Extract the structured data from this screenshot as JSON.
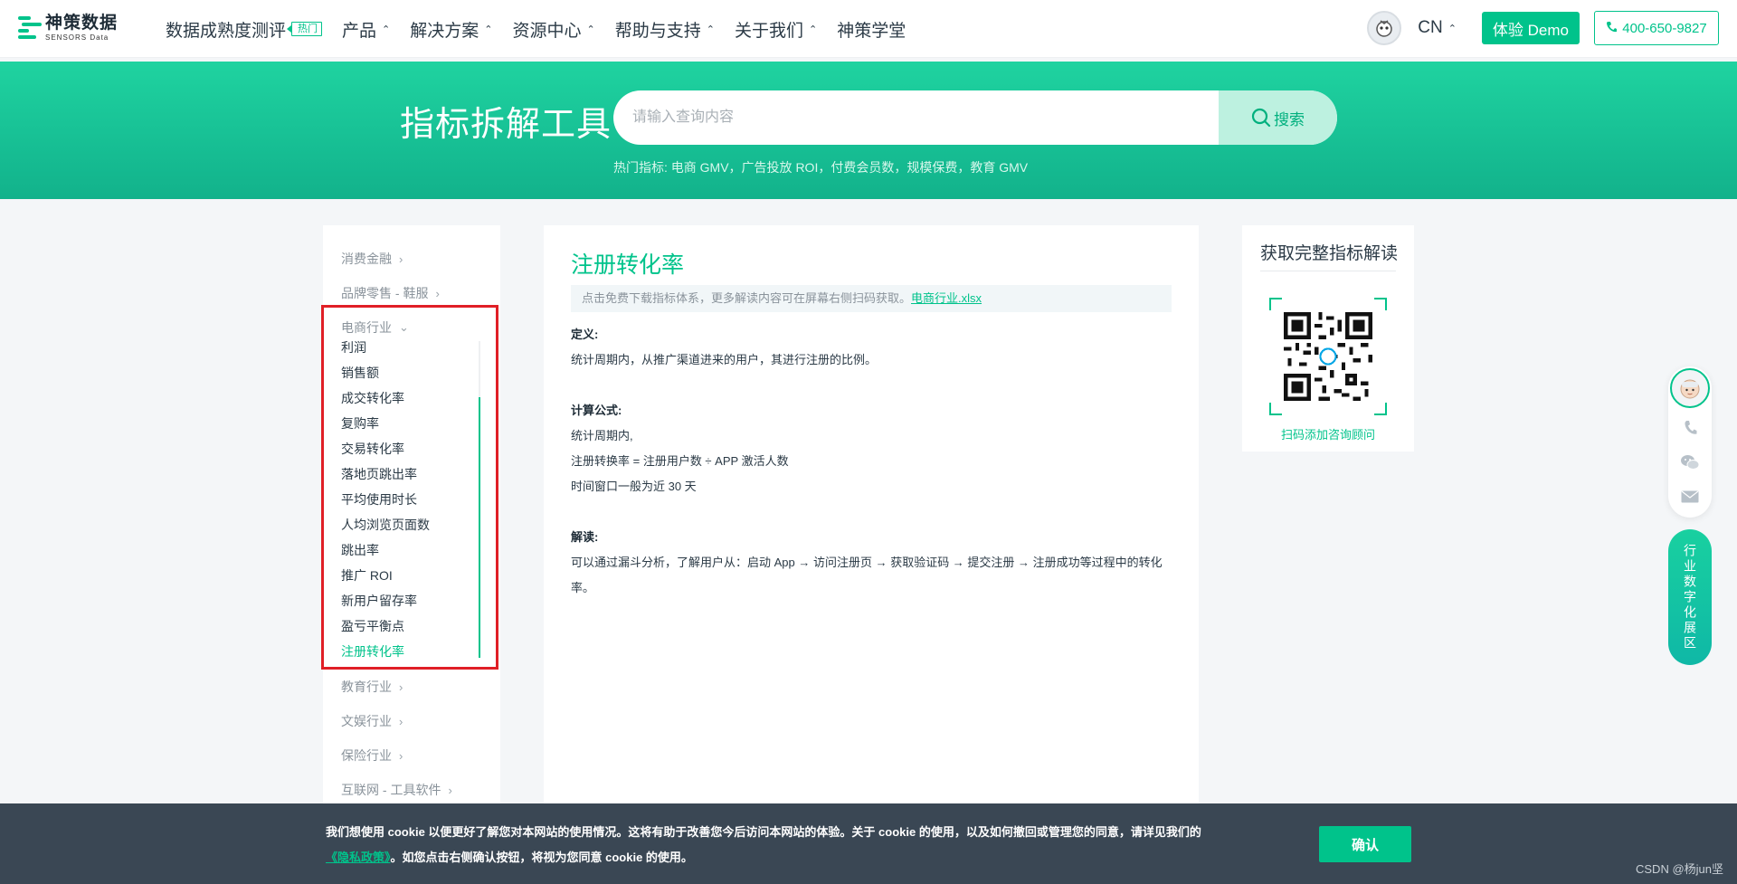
{
  "header": {
    "logo_cn": "神策数据",
    "logo_en": "SENSORS Data",
    "nav": [
      {
        "label": "数据成熟度测评",
        "tag": "热门",
        "dropdown": false
      },
      {
        "label": "产品",
        "dropdown": true
      },
      {
        "label": "解决方案",
        "dropdown": true
      },
      {
        "label": "资源中心",
        "dropdown": true
      },
      {
        "label": "帮助与支持",
        "dropdown": true
      },
      {
        "label": "关于我们",
        "dropdown": true
      },
      {
        "label": "神策学堂",
        "dropdown": false
      }
    ],
    "lang": "CN",
    "demo_label": "体验 Demo",
    "phone": "400-650-9827"
  },
  "hero": {
    "title": "指标拆解工具",
    "search_placeholder": "请输入查询内容",
    "search_button": "搜索",
    "hot_label": "热门指标:",
    "hot_items": "电商 GMV，广告投放 ROI，付费会员数，规模保费，教育 GMV"
  },
  "sidebar": {
    "categories_top": [
      "消费金融",
      "品牌零售 - 鞋服"
    ],
    "expanded_category": "电商行业",
    "sub_items": [
      "利润",
      "销售额",
      "成交转化率",
      "复购率",
      "交易转化率",
      "落地页跳出率",
      "平均使用时长",
      "人均浏览页面数",
      "跳出率",
      "推广 ROI",
      "新用户留存率",
      "盈亏平衡点",
      "注册转化率"
    ],
    "active_item": "注册转化率",
    "categories_bottom": [
      "教育行业",
      "文娱行业",
      "保险行业",
      "互联网 - 工具软件"
    ]
  },
  "main": {
    "title": "注册转化率",
    "notice": "点击免费下载指标体系，更多解读内容可在屏幕右侧扫码获取。",
    "notice_link": "电商行业.xlsx",
    "definition_label": "定义:",
    "definition": "统计周期内，从推广渠道进来的用户，其进行注册的比例。",
    "formula_label": "计算公式:",
    "formula_lines": [
      "统计周期内,",
      "注册转换率 = 注册用户数 ÷ APP 激活人数",
      "时间窗口一般为近 30 天"
    ],
    "interpretation_label": "解读:",
    "interpretation": "可以通过漏斗分析，了解用户从：启动 App → 访问注册页 → 获取验证码 → 提交注册 → 注册成功等过程中的转化率。"
  },
  "qr_card": {
    "title": "获取完整指标解读",
    "caption": "扫码添加咨询顾问"
  },
  "float": {
    "industry_tab": "行业数字化展区"
  },
  "cookie": {
    "text_1": "我们想使用 cookie 以便更好了解您对本网站的使用情况。这将有助于改善您今后访问本网站的体验。关于 cookie 的使用，以及如何撤回或管理您的同意，请详见我们的",
    "policy_link": "《隐私政策》",
    "text_2": "。如您点击右侧确认按钮，将视为您同意 cookie 的使用。",
    "confirm": "确认"
  },
  "watermark": "CSDN @杨jun坚",
  "colors": {
    "accent": "#00c38b",
    "hero_gradient": "#1fd3a0",
    "cookie_bg": "#3a4754",
    "highlight": "#e01f26"
  }
}
